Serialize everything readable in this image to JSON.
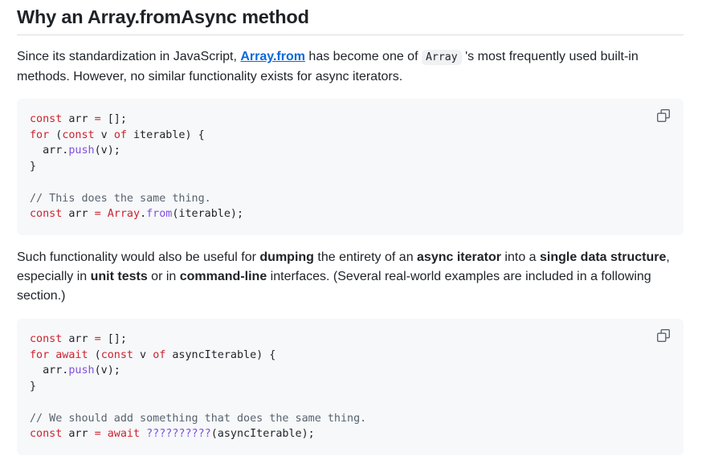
{
  "heading": "Why an Array.fromAsync method",
  "para1": {
    "t1": "Since its standardization in JavaScript, ",
    "link": "Array.from",
    "t2": " has become one of ",
    "code": "Array",
    "t3": " 's most frequently used built-in methods. However, no similar functionality exists for async iterators."
  },
  "code1": {
    "l1": [
      [
        "kw",
        "const"
      ],
      [
        "plain",
        " arr "
      ],
      [
        "kw",
        "="
      ],
      [
        "plain",
        " [];"
      ]
    ],
    "l2": [
      [
        "kw",
        "for"
      ],
      [
        "plain",
        " ("
      ],
      [
        "kw",
        "const"
      ],
      [
        "plain",
        " v "
      ],
      [
        "kw",
        "of"
      ],
      [
        "plain",
        " iterable) {"
      ]
    ],
    "l3": [
      [
        "plain",
        "  arr."
      ],
      [
        "fn",
        "push"
      ],
      [
        "plain",
        "(v);"
      ]
    ],
    "l4": [
      [
        "plain",
        "}"
      ]
    ],
    "l5": [
      [
        "plain",
        ""
      ]
    ],
    "l6": [
      [
        "cm",
        "// This does the same thing."
      ]
    ],
    "l7": [
      [
        "kw",
        "const"
      ],
      [
        "plain",
        " arr "
      ],
      [
        "kw",
        "="
      ],
      [
        "plain",
        " "
      ],
      [
        "kw",
        "Array"
      ],
      [
        "plain",
        "."
      ],
      [
        "fn",
        "from"
      ],
      [
        "plain",
        "(iterable);"
      ]
    ]
  },
  "para2": {
    "t1": "Such functionality would also be useful for ",
    "b1": "dumping",
    "t2": " the entirety of an ",
    "b2": "async iterator",
    "t3": " into a ",
    "b3": "single data structure",
    "t4": ", especially in ",
    "b4": "unit tests",
    "t5": " or in ",
    "b5": "command-line",
    "t6": " interfaces. (Several real-world examples are included in a following section.)"
  },
  "code2": {
    "l1": [
      [
        "kw",
        "const"
      ],
      [
        "plain",
        " arr "
      ],
      [
        "kw",
        "="
      ],
      [
        "plain",
        " [];"
      ]
    ],
    "l2": [
      [
        "kw",
        "for"
      ],
      [
        "plain",
        " "
      ],
      [
        "kw",
        "await"
      ],
      [
        "plain",
        " ("
      ],
      [
        "kw",
        "const"
      ],
      [
        "plain",
        " v "
      ],
      [
        "kw",
        "of"
      ],
      [
        "plain",
        " asyncIterable) {"
      ]
    ],
    "l3": [
      [
        "plain",
        "  arr."
      ],
      [
        "fn",
        "push"
      ],
      [
        "plain",
        "(v);"
      ]
    ],
    "l4": [
      [
        "plain",
        "}"
      ]
    ],
    "l5": [
      [
        "plain",
        ""
      ]
    ],
    "l6": [
      [
        "cm",
        "// We should add something that does the same thing."
      ]
    ],
    "l7": [
      [
        "kw",
        "const"
      ],
      [
        "plain",
        " arr "
      ],
      [
        "kw",
        "="
      ],
      [
        "plain",
        " "
      ],
      [
        "kw",
        "await"
      ],
      [
        "plain",
        " "
      ],
      [
        "fn",
        "??????????"
      ],
      [
        "plain",
        "(asyncIterable);"
      ]
    ]
  },
  "icons": {
    "copy": "copy-icon"
  }
}
